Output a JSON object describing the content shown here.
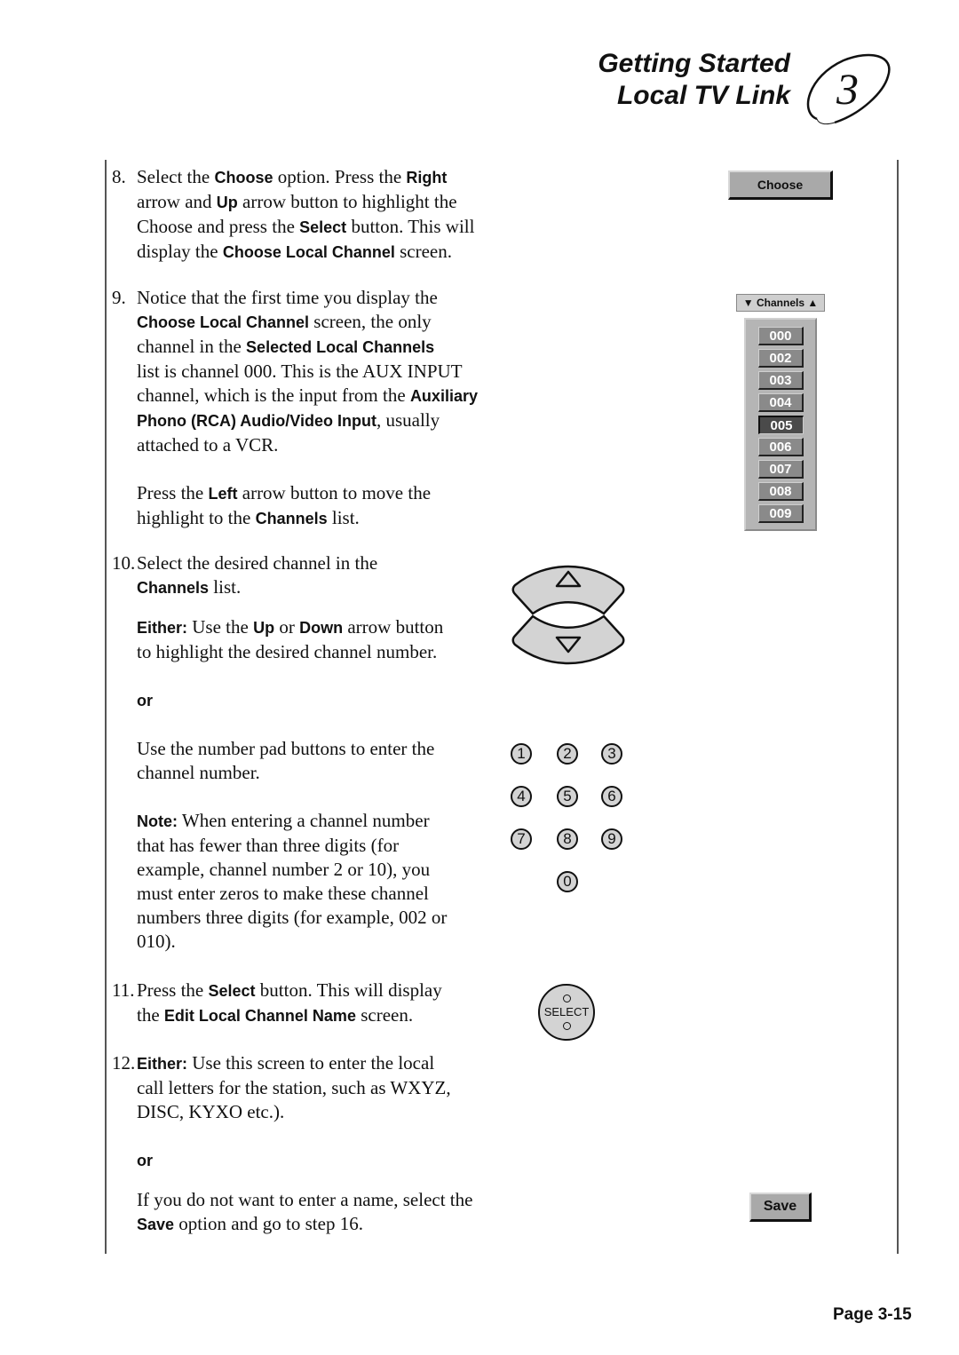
{
  "header": {
    "line1": "Getting Started",
    "line2": "Local TV Link",
    "chapter_number": "3"
  },
  "steps": {
    "s8": {
      "num": "8.",
      "l1a": "Select the ",
      "l1b": "Choose",
      "l1c": " option.  Press the ",
      "l1d": "Right",
      "l2a": "arrow and ",
      "l2b": "Up",
      "l2c": " arrow button to highlight the",
      "l3a": "Choose and press the ",
      "l3b": "Select",
      "l3c": " button.  This will",
      "l4a": "display the ",
      "l4b": "Choose Local Channel",
      "l4c": " screen."
    },
    "s9": {
      "num": "9.",
      "l1": "Notice that the first time you display the",
      "l2a": "Choose Local Channel",
      "l2b": " screen, the only",
      "l3a": "channel in the ",
      "l3b": "Selected Local Channels",
      "l4": "list is channel 000.  This is the AUX INPUT",
      "l5a": "channel, which is the input from the ",
      "l5b": "Auxiliary",
      "l6a": "Phono (RCA) Audio/Video Input",
      "l6b": ", usually",
      "l7": "attached to a VCR.",
      "p2a": "Press the ",
      "p2b": "Left",
      "p2c": " arrow button to move the",
      "p2d": "highlight to the ",
      "p2e": "Channels",
      "p2f": " list."
    },
    "s10": {
      "num": "10.",
      "l1": "Select the desired channel in the",
      "l2a": "Channels",
      "l2b": " list.",
      "e1a": "Either:",
      "e1b": "  Use the ",
      "e1c": "Up",
      "e1d": " or ",
      "e1e": "Down",
      "e1f": " arrow button",
      "e2": "to highlight the desired channel number.",
      "or": "or",
      "n1": "Use the number pad buttons to enter the",
      "n2": "channel number.",
      "note_label": "Note:",
      "note1": "  When entering a channel number",
      "note2": "that has fewer than three digits (for",
      "note3": "example, channel number 2 or 10), you",
      "note4": "must enter zeros to make these channel",
      "note5": "numbers three digits (for example, 002 or",
      "note6": "010)."
    },
    "s11": {
      "num": "11.",
      "l1a": "Press the ",
      "l1b": "Select",
      "l1c": " button.  This will display",
      "l2a": "the ",
      "l2b": "Edit Local Channel Name",
      "l2c": " screen."
    },
    "s12": {
      "num": "12.",
      "l1a": "Either:",
      "l1b": "  Use this screen to enter the local",
      "l2": "call letters for the station, such as WXYZ,",
      "l3": "DISC, KYXO etc.).",
      "or": "or",
      "l4": "If you do not want to enter a name, select the",
      "l5a": "Save",
      "l5b": " option and go to step 16."
    }
  },
  "ui": {
    "choose_button": "Choose",
    "channels_header": "Channels",
    "channels_down_icon": "▼",
    "channels_up_icon": "▲",
    "channels": [
      "000",
      "002",
      "003",
      "004",
      "005",
      "006",
      "007",
      "008",
      "009"
    ],
    "selected_channel": "005",
    "keypad": [
      "1",
      "2",
      "3",
      "4",
      "5",
      "6",
      "7",
      "8",
      "9",
      "0"
    ],
    "select_label": "SELECT",
    "save_button": "Save"
  },
  "footer": {
    "page_label": "Page 3-15"
  }
}
